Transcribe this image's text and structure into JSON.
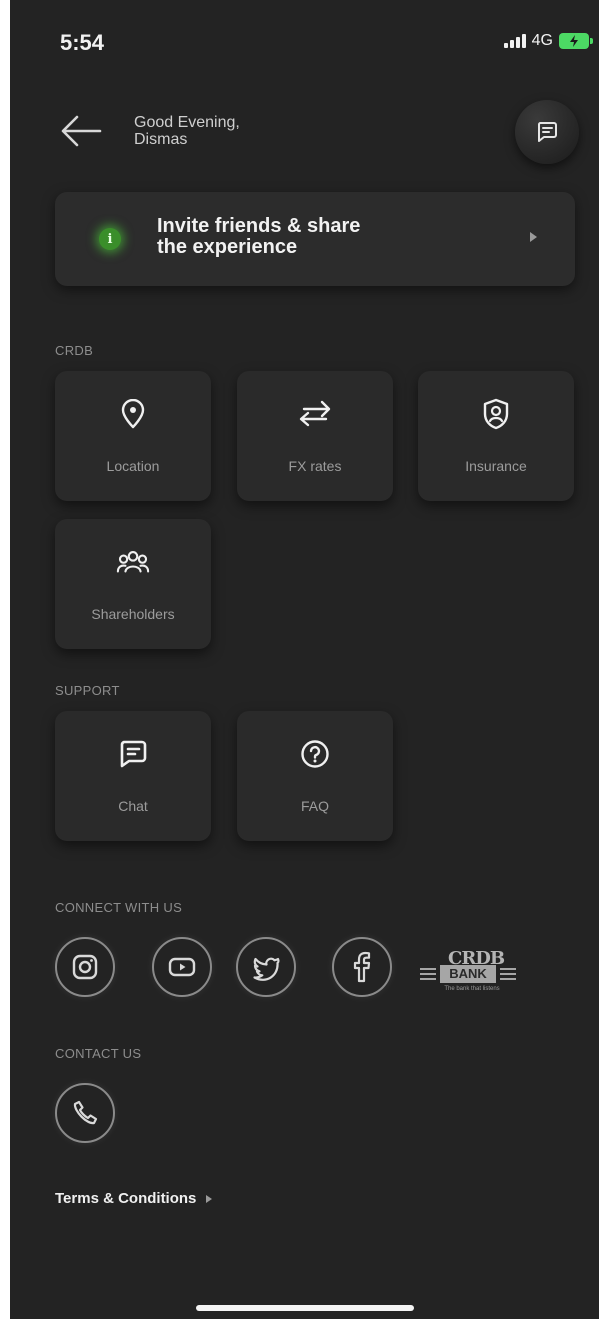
{
  "status_bar": {
    "time": "5:54",
    "network": "4G"
  },
  "header": {
    "greeting_line1": "Good Evening,",
    "greeting_line2": "Dismas"
  },
  "invite_banner": {
    "title_line1": "Invite friends & share",
    "title_line2": "the experience"
  },
  "sections": {
    "crdb_title": "CRDB",
    "crdb_tiles": [
      {
        "label": "Location",
        "icon": "location-pin-icon"
      },
      {
        "label": "FX rates",
        "icon": "exchange-arrows-icon"
      },
      {
        "label": "Insurance",
        "icon": "shield-user-icon"
      },
      {
        "label": "Shareholders",
        "icon": "people-group-icon"
      }
    ],
    "support_title": "SUPPORT",
    "support_tiles": [
      {
        "label": "Chat",
        "icon": "chat-icon"
      },
      {
        "label": "FAQ",
        "icon": "question-icon"
      }
    ],
    "connect_title": "CONNECT WITH US",
    "connect_icons": [
      "instagram-icon",
      "youtube-icon",
      "twitter-icon",
      "facebook-icon"
    ],
    "logo": {
      "top": "CRDB",
      "bank": "BANK",
      "tagline": "The bank that listens"
    },
    "contact_title": "CONTACT US",
    "contact_icon": "phone-icon"
  },
  "footer": {
    "terms_label": "Terms & Conditions"
  },
  "colors": {
    "background": "#232323",
    "tile": "#2a2a2a",
    "accent_green": "#4cd964",
    "info_green": "#3a8e2a"
  }
}
